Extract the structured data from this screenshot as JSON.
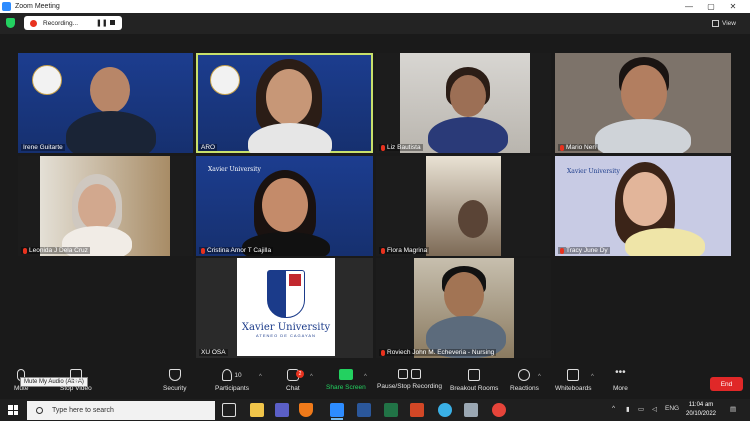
{
  "window": {
    "title": "Zoom Meeting",
    "controls": [
      "—",
      "▢",
      "✕"
    ]
  },
  "recording": {
    "label": "Recording..."
  },
  "view": {
    "label": "View"
  },
  "participants": [
    {
      "name": "Irene Guitarte"
    },
    {
      "name": "ARO"
    },
    {
      "name": "Liz Bautista",
      "muted": true
    },
    {
      "name": "Mario Neri",
      "muted": true
    },
    {
      "name": "Leonida J Dela Cruz",
      "muted": true
    },
    {
      "name": "Cristina Amor T Cajilla",
      "muted": true
    },
    {
      "name": "Flora Magrina",
      "muted": true
    },
    {
      "name": "Tracy June Dy",
      "muted": true
    },
    {
      "name": "XU OSA"
    },
    {
      "name": "Roviech John M. Echeveria - Nursing",
      "muted": true
    }
  ],
  "xu_logo": {
    "name": "Xavier University",
    "subtitle": "ATENEO DE CAGAYAN"
  },
  "tile_logo_text": "Xavier University",
  "toolbar": {
    "mute": "Mute",
    "mute_tooltip": "Mute My Audio (Alt+A)",
    "video": "Stop Video",
    "security": "Security",
    "participants": "Participants",
    "participants_count": "10",
    "chat": "Chat",
    "chat_badge": "2",
    "share": "Share Screen",
    "record": "Pause/Stop Recording",
    "breakout": "Breakout Rooms",
    "reactions": "Reactions",
    "whiteboards": "Whiteboards",
    "more": "More",
    "end": "End"
  },
  "taskbar": {
    "search_placeholder": "Type here to search",
    "lang": "ENG",
    "time": "11:04 am",
    "date": "20/10/2022"
  }
}
